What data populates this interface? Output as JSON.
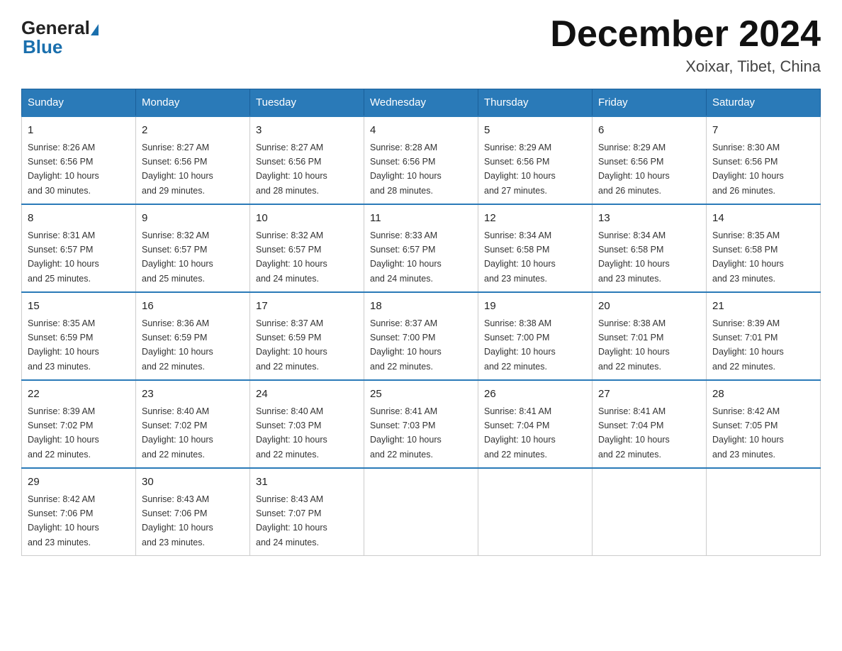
{
  "logo": {
    "general": "General",
    "blue": "Blue",
    "triangle": "▶"
  },
  "title": "December 2024",
  "subtitle": "Xoixar, Tibet, China",
  "days_of_week": [
    "Sunday",
    "Monday",
    "Tuesday",
    "Wednesday",
    "Thursday",
    "Friday",
    "Saturday"
  ],
  "weeks": [
    {
      "days": [
        {
          "num": "1",
          "sunrise": "8:26 AM",
          "sunset": "6:56 PM",
          "daylight": "10 hours and 30 minutes."
        },
        {
          "num": "2",
          "sunrise": "8:27 AM",
          "sunset": "6:56 PM",
          "daylight": "10 hours and 29 minutes."
        },
        {
          "num": "3",
          "sunrise": "8:27 AM",
          "sunset": "6:56 PM",
          "daylight": "10 hours and 28 minutes."
        },
        {
          "num": "4",
          "sunrise": "8:28 AM",
          "sunset": "6:56 PM",
          "daylight": "10 hours and 28 minutes."
        },
        {
          "num": "5",
          "sunrise": "8:29 AM",
          "sunset": "6:56 PM",
          "daylight": "10 hours and 27 minutes."
        },
        {
          "num": "6",
          "sunrise": "8:29 AM",
          "sunset": "6:56 PM",
          "daylight": "10 hours and 26 minutes."
        },
        {
          "num": "7",
          "sunrise": "8:30 AM",
          "sunset": "6:56 PM",
          "daylight": "10 hours and 26 minutes."
        }
      ]
    },
    {
      "days": [
        {
          "num": "8",
          "sunrise": "8:31 AM",
          "sunset": "6:57 PM",
          "daylight": "10 hours and 25 minutes."
        },
        {
          "num": "9",
          "sunrise": "8:32 AM",
          "sunset": "6:57 PM",
          "daylight": "10 hours and 25 minutes."
        },
        {
          "num": "10",
          "sunrise": "8:32 AM",
          "sunset": "6:57 PM",
          "daylight": "10 hours and 24 minutes."
        },
        {
          "num": "11",
          "sunrise": "8:33 AM",
          "sunset": "6:57 PM",
          "daylight": "10 hours and 24 minutes."
        },
        {
          "num": "12",
          "sunrise": "8:34 AM",
          "sunset": "6:58 PM",
          "daylight": "10 hours and 23 minutes."
        },
        {
          "num": "13",
          "sunrise": "8:34 AM",
          "sunset": "6:58 PM",
          "daylight": "10 hours and 23 minutes."
        },
        {
          "num": "14",
          "sunrise": "8:35 AM",
          "sunset": "6:58 PM",
          "daylight": "10 hours and 23 minutes."
        }
      ]
    },
    {
      "days": [
        {
          "num": "15",
          "sunrise": "8:35 AM",
          "sunset": "6:59 PM",
          "daylight": "10 hours and 23 minutes."
        },
        {
          "num": "16",
          "sunrise": "8:36 AM",
          "sunset": "6:59 PM",
          "daylight": "10 hours and 22 minutes."
        },
        {
          "num": "17",
          "sunrise": "8:37 AM",
          "sunset": "6:59 PM",
          "daylight": "10 hours and 22 minutes."
        },
        {
          "num": "18",
          "sunrise": "8:37 AM",
          "sunset": "7:00 PM",
          "daylight": "10 hours and 22 minutes."
        },
        {
          "num": "19",
          "sunrise": "8:38 AM",
          "sunset": "7:00 PM",
          "daylight": "10 hours and 22 minutes."
        },
        {
          "num": "20",
          "sunrise": "8:38 AM",
          "sunset": "7:01 PM",
          "daylight": "10 hours and 22 minutes."
        },
        {
          "num": "21",
          "sunrise": "8:39 AM",
          "sunset": "7:01 PM",
          "daylight": "10 hours and 22 minutes."
        }
      ]
    },
    {
      "days": [
        {
          "num": "22",
          "sunrise": "8:39 AM",
          "sunset": "7:02 PM",
          "daylight": "10 hours and 22 minutes."
        },
        {
          "num": "23",
          "sunrise": "8:40 AM",
          "sunset": "7:02 PM",
          "daylight": "10 hours and 22 minutes."
        },
        {
          "num": "24",
          "sunrise": "8:40 AM",
          "sunset": "7:03 PM",
          "daylight": "10 hours and 22 minutes."
        },
        {
          "num": "25",
          "sunrise": "8:41 AM",
          "sunset": "7:03 PM",
          "daylight": "10 hours and 22 minutes."
        },
        {
          "num": "26",
          "sunrise": "8:41 AM",
          "sunset": "7:04 PM",
          "daylight": "10 hours and 22 minutes."
        },
        {
          "num": "27",
          "sunrise": "8:41 AM",
          "sunset": "7:04 PM",
          "daylight": "10 hours and 22 minutes."
        },
        {
          "num": "28",
          "sunrise": "8:42 AM",
          "sunset": "7:05 PM",
          "daylight": "10 hours and 23 minutes."
        }
      ]
    },
    {
      "days": [
        {
          "num": "29",
          "sunrise": "8:42 AM",
          "sunset": "7:06 PM",
          "daylight": "10 hours and 23 minutes."
        },
        {
          "num": "30",
          "sunrise": "8:43 AM",
          "sunset": "7:06 PM",
          "daylight": "10 hours and 23 minutes."
        },
        {
          "num": "31",
          "sunrise": "8:43 AM",
          "sunset": "7:07 PM",
          "daylight": "10 hours and 24 minutes."
        },
        {
          "num": "",
          "sunrise": "",
          "sunset": "",
          "daylight": ""
        },
        {
          "num": "",
          "sunrise": "",
          "sunset": "",
          "daylight": ""
        },
        {
          "num": "",
          "sunrise": "",
          "sunset": "",
          "daylight": ""
        },
        {
          "num": "",
          "sunrise": "",
          "sunset": "",
          "daylight": ""
        }
      ]
    }
  ],
  "labels": {
    "sunrise": "Sunrise:",
    "sunset": "Sunset:",
    "daylight": "Daylight:"
  }
}
